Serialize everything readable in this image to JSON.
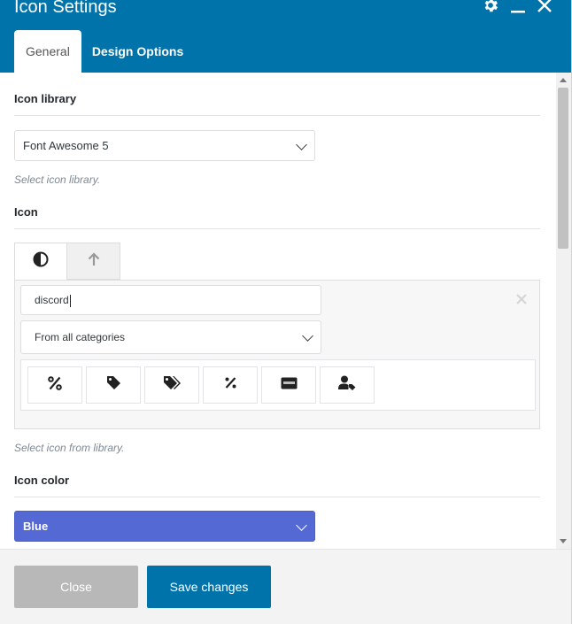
{
  "window": {
    "title": "Icon Settings"
  },
  "header_icons": [
    "gear-icon",
    "minimize-icon",
    "close-icon"
  ],
  "tabs": [
    {
      "label": "General",
      "active": true
    },
    {
      "label": "Design Options",
      "active": false
    }
  ],
  "icon_library": {
    "label": "Icon library",
    "selected": "Font Awesome 5",
    "helper": "Select icon library."
  },
  "icon": {
    "label": "Icon",
    "picker_tabs": [
      "half-circle-icon",
      "arrow-up-icon"
    ],
    "search_value": "discord",
    "category_selected": "From all categories",
    "results": [
      "percent-icon",
      "tag-icon",
      "tags-icon",
      "percentage-icon",
      "credit-card-icon",
      "user-tag-icon"
    ],
    "helper": "Select icon from library."
  },
  "icon_color": {
    "label": "Icon color",
    "selected": "Blue",
    "color": "#5469d4"
  },
  "footer": {
    "close_label": "Close",
    "save_label": "Save changes"
  },
  "colors": {
    "accent": "#0073aa",
    "disabled": "#b8b8b8"
  }
}
